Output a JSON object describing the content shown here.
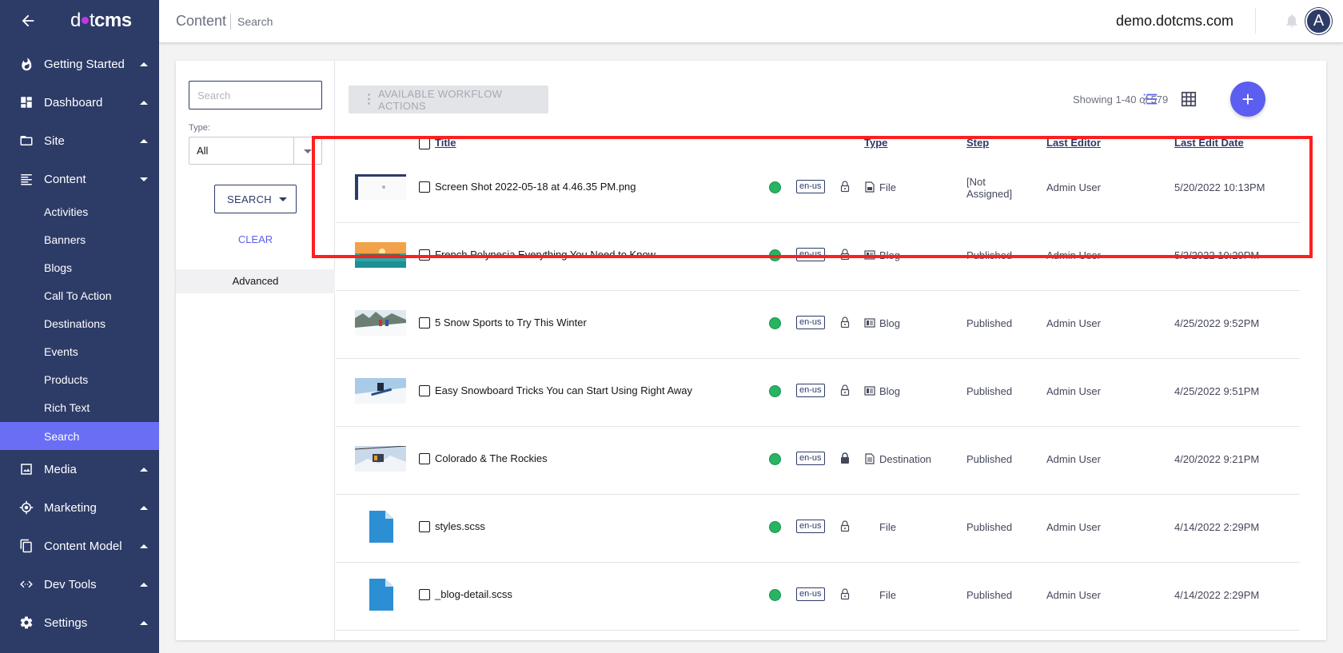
{
  "sidebar": {
    "logo_left": "d",
    "logo_mid": "t",
    "logo_right": "cms",
    "items": [
      {
        "label": "Getting Started",
        "icon": "flame-icon"
      },
      {
        "label": "Dashboard",
        "icon": "dashboard-icon"
      },
      {
        "label": "Site",
        "icon": "folder-icon"
      },
      {
        "label": "Content",
        "icon": "content-icon"
      },
      {
        "label": "Media",
        "icon": "image-icon"
      },
      {
        "label": "Marketing",
        "icon": "target-icon"
      },
      {
        "label": "Content Model",
        "icon": "copy-icon"
      },
      {
        "label": "Dev Tools",
        "icon": "code-icon"
      },
      {
        "label": "Settings",
        "icon": "gear-icon"
      }
    ],
    "content_subitems": [
      {
        "label": "Activities"
      },
      {
        "label": "Banners"
      },
      {
        "label": "Blogs"
      },
      {
        "label": "Call To Action"
      },
      {
        "label": "Destinations"
      },
      {
        "label": "Events"
      },
      {
        "label": "Products"
      },
      {
        "label": "Rich Text"
      },
      {
        "label": "Search"
      }
    ]
  },
  "topbar": {
    "breadcrumb_section": "Content",
    "breadcrumb_page": "Search",
    "site": "demo.dotcms.com",
    "avatar_initial": "A"
  },
  "filters": {
    "search_placeholder": "Search",
    "type_label": "Type:",
    "type_value": "All",
    "search_button": "SEARCH",
    "clear_button": "CLEAR",
    "advanced": "Advanced"
  },
  "results": {
    "workflow_button": "AVAILABLE WORKFLOW ACTIONS",
    "showing": "Showing 1-40 of 579",
    "add_button": "+",
    "columns": {
      "title": "Title",
      "type": "Type",
      "step": "Step",
      "last_editor": "Last Editor",
      "last_edit_date": "Last Edit Date"
    },
    "rows": [
      {
        "title": "Screen Shot 2022-05-18 at 4.46.35 PM.png",
        "lang": "en-us",
        "type": "File",
        "type_icon": "image-file-icon",
        "step": "[Not Assigned]",
        "editor": "Admin User",
        "date": "5/20/2022 10:13PM",
        "thumb": "screenshot"
      },
      {
        "title": "French Polynesia Everything You Need to Know",
        "lang": "en-us",
        "type": "Blog",
        "type_icon": "newspaper-icon",
        "step": "Published",
        "editor": "Admin User",
        "date": "5/3/2022 10:29PM",
        "thumb": "beach"
      },
      {
        "title": "5 Snow Sports to Try This Winter",
        "lang": "en-us",
        "type": "Blog",
        "type_icon": "newspaper-icon",
        "step": "Published",
        "editor": "Admin User",
        "date": "4/25/2022 9:52PM",
        "thumb": "ski"
      },
      {
        "title": "Easy Snowboard Tricks You can Start Using Right Away",
        "lang": "en-us",
        "type": "Blog",
        "type_icon": "newspaper-icon",
        "step": "Published",
        "editor": "Admin User",
        "date": "4/25/2022 9:51PM",
        "thumb": "snowboard"
      },
      {
        "title": "Colorado & The Rockies",
        "lang": "en-us",
        "type": "Destination",
        "type_icon": "document-icon",
        "step": "Published",
        "editor": "Admin User",
        "date": "4/20/2022 9:21PM",
        "thumb": "chairlift"
      },
      {
        "title": "styles.scss",
        "lang": "en-us",
        "type": "File",
        "type_icon": "",
        "step": "Published",
        "editor": "Admin User",
        "date": "4/14/2022 2:29PM",
        "thumb": "file"
      },
      {
        "title": "_blog-detail.scss",
        "lang": "en-us",
        "type": "File",
        "type_icon": "",
        "step": "Published",
        "editor": "Admin User",
        "date": "4/14/2022 2:29PM",
        "thumb": "file"
      }
    ]
  },
  "colors": {
    "sidebar": "#2d3b67",
    "accent": "#5b5ef0",
    "active_item": "#6a6ef4",
    "status_published": "#27b463",
    "highlight": "#ff1e1e"
  }
}
